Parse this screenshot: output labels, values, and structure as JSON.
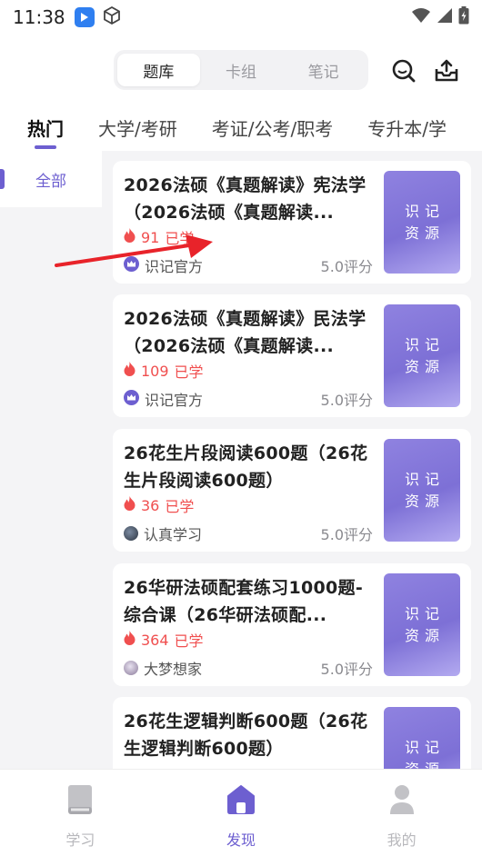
{
  "status": {
    "time": "11:38"
  },
  "segments": [
    {
      "label": "题库",
      "active": true
    },
    {
      "label": "卡组",
      "active": false
    },
    {
      "label": "笔记",
      "active": false
    }
  ],
  "categories": [
    "热门",
    "大学/考研",
    "考证/公考/职考",
    "专升本/学"
  ],
  "sidebar": {
    "items": [
      {
        "label": "全部"
      }
    ]
  },
  "cards": [
    {
      "title": "2026法硕《真题解读》宪法学（2026法硕《真题解读...",
      "learners": "91",
      "learned_suffix": "已学",
      "author": "识记官方",
      "rating": "5.0评分",
      "cover": "识记资源"
    },
    {
      "title": "2026法硕《真题解读》民法学（2026法硕《真题解读...",
      "learners": "109",
      "learned_suffix": "已学",
      "author": "识记官方",
      "rating": "5.0评分",
      "cover": "识记资源"
    },
    {
      "title": "26花生片段阅读600题（26花生片段阅读600题）",
      "learners": "36",
      "learned_suffix": "已学",
      "author": "认真学习",
      "rating": "5.0评分",
      "cover": "识记资源"
    },
    {
      "title": "26华研法硕配套练习1000题-综合课（26华研法硕配...",
      "learners": "364",
      "learned_suffix": "已学",
      "author": "大梦想家",
      "rating": "5.0评分",
      "cover": "识记资源"
    },
    {
      "title": "26花生逻辑判断600题（26花生逻辑判断600题）",
      "learners": "",
      "learned_suffix": "",
      "author": "",
      "rating": "",
      "cover": "识记资源"
    }
  ],
  "bottom_nav": [
    {
      "label": "学习",
      "active": false
    },
    {
      "label": "发现",
      "active": true
    },
    {
      "label": "我的",
      "active": false
    }
  ],
  "colors": {
    "accent": "#6d5fd0",
    "hot": "#f04f4f",
    "arrow": "#e8232a"
  }
}
